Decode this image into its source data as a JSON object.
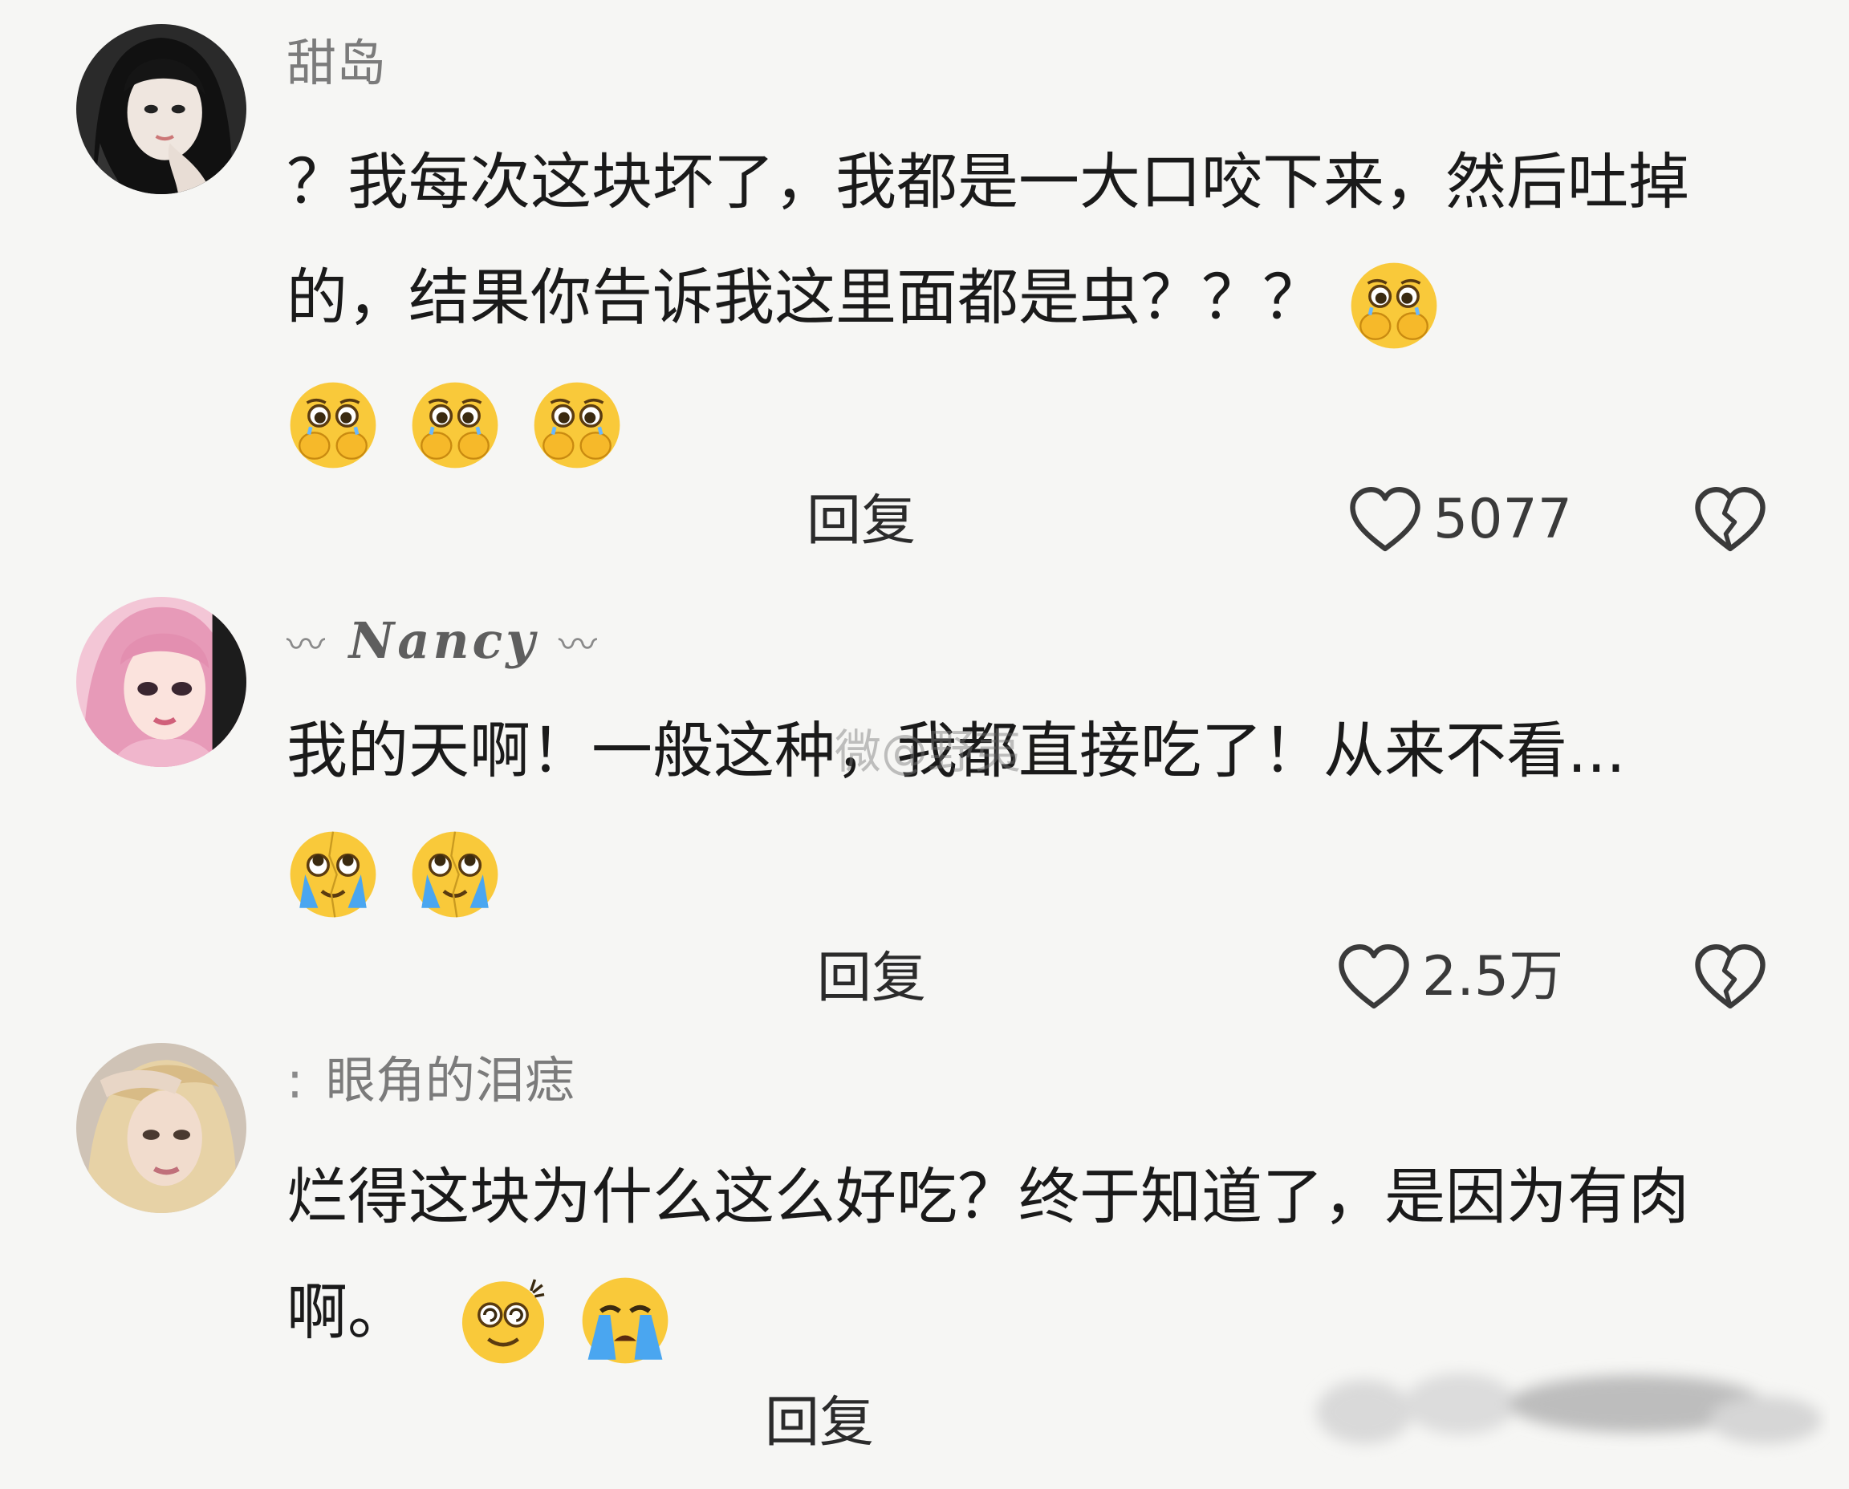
{
  "comments": [
    {
      "username": "甜岛",
      "text": "？我每次这块坏了，我都是一大口咬下来，然后吐掉的，结果你告诉我这里面都是虫？？？",
      "emojis": [
        "pleading-hands-face-emoji",
        "pleading-hands-face-emoji",
        "pleading-hands-face-emoji",
        "pleading-hands-face-emoji"
      ],
      "reply_label": "回复",
      "likes": "5077"
    },
    {
      "username_deco_left": "〰",
      "username": "Nancy",
      "username_deco_right": "〰",
      "text": "我的天啊！一般这种，我都直接吃了！从来不看...",
      "emojis": [
        "crying-eyes-up-emoji",
        "crying-eyes-up-emoji"
      ],
      "reply_label": "回复",
      "likes": "2.5万"
    },
    {
      "username_prefix": ":",
      "username": "眼角的泪痣",
      "text": "烂得这块为什么这么好吃？终于知道了，是因为有肉啊。",
      "emojis": [
        "dizzy-smile-emoji",
        "loudly-crying-emoji"
      ],
      "reply_label": "回复"
    }
  ],
  "watermark": "微@野夷",
  "icons": {
    "like": "heart-outline-icon",
    "dislike": "broken-heart-icon"
  },
  "colors": {
    "background": "#f6f6f4",
    "text": "#1a1a1a",
    "username": "#7b7b7b",
    "icon": "#3a3a3a"
  }
}
